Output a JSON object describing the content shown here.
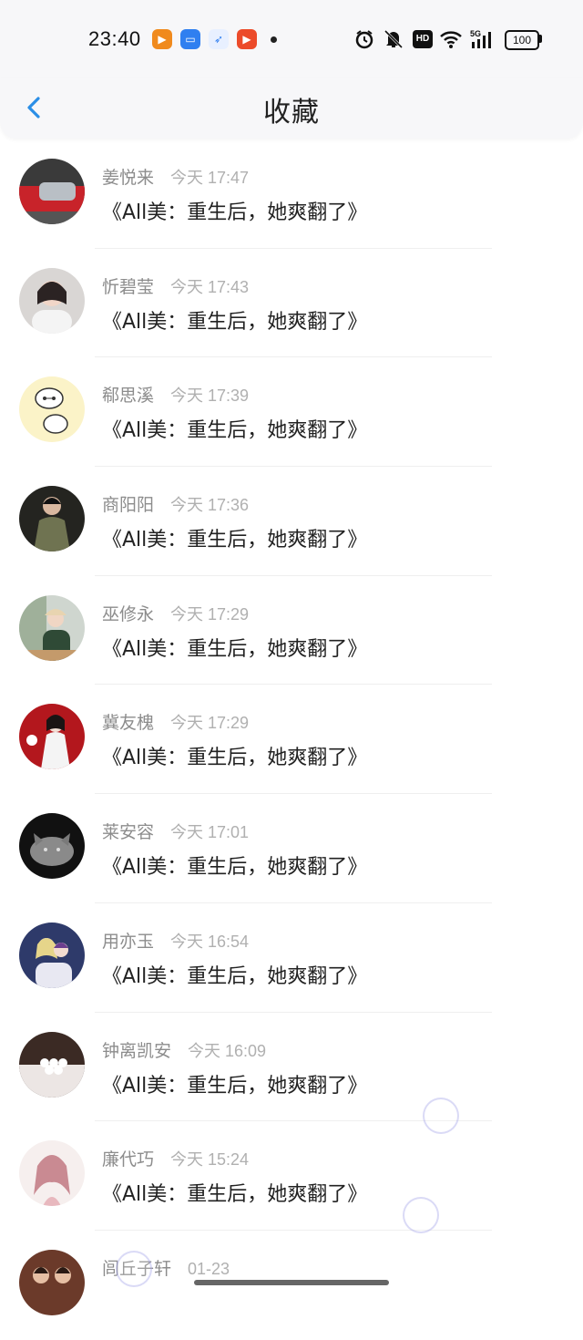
{
  "status_bar": {
    "time": "23:40",
    "network": "5G",
    "battery": "100",
    "hd": "HD",
    "notification_icons": [
      "app-icon-orange",
      "app-icon-blue",
      "app-icon-compass",
      "app-icon-video"
    ],
    "system_icons": [
      "alarm-icon",
      "mute-icon",
      "hd-icon",
      "wifi-icon",
      "signal-icon",
      "battery-icon"
    ]
  },
  "header": {
    "title": "收藏",
    "back_icon": "chevron-left-icon",
    "accent_color": "#2a8ee6"
  },
  "items": [
    {
      "name": "姜悦来",
      "time": "今天 17:47",
      "title": "《All美：重生后，她爽翻了》"
    },
    {
      "name": "忻碧莹",
      "time": "今天 17:43",
      "title": "《All美：重生后，她爽翻了》"
    },
    {
      "name": "郗思溪",
      "time": "今天 17:39",
      "title": "《All美：重生后，她爽翻了》"
    },
    {
      "name": "商阳阳",
      "time": "今天 17:36",
      "title": "《All美：重生后，她爽翻了》"
    },
    {
      "name": "巫修永",
      "time": "今天 17:29",
      "title": "《All美：重生后，她爽翻了》"
    },
    {
      "name": "冀友槐",
      "time": "今天 17:29",
      "title": "《All美：重生后，她爽翻了》"
    },
    {
      "name": "莱安容",
      "time": "今天 17:01",
      "title": "《All美：重生后，她爽翻了》"
    },
    {
      "name": "用亦玉",
      "time": "今天 16:54",
      "title": "《All美：重生后，她爽翻了》"
    },
    {
      "name": "钟离凯安",
      "time": "今天 16:09",
      "title": "《All美：重生后，她爽翻了》"
    },
    {
      "name": "廉代巧",
      "time": "今天 15:24",
      "title": "《All美：重生后，她爽翻了》"
    },
    {
      "name": "闾丘子轩",
      "time": "01-23",
      "title": ""
    }
  ]
}
